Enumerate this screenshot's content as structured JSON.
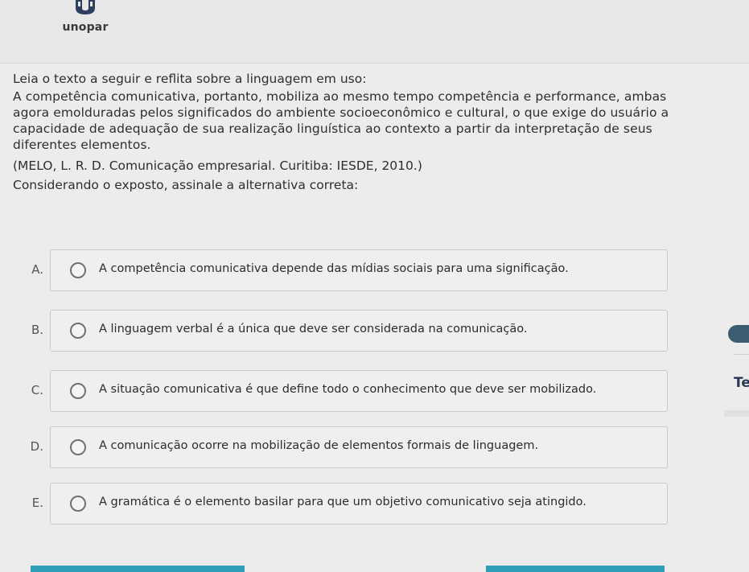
{
  "header": {
    "logo_text": "unopar",
    "logo_color": "#2f3f5f"
  },
  "question": {
    "intro": "Leia o texto a seguir e reflita sobre a linguagem em uso:",
    "quote_lines": [
      "A competência comunicativa, portanto, mobiliza ao mesmo tempo competência e performance, ambas",
      "agora emolduradas pelos significados do ambiente socioeconômico e cultural, o que exige do usuário a",
      "capacidade de adequação de sua realização linguística ao contexto a partir da interpretação de seus",
      "diferentes elementos."
    ],
    "citation": "(MELO, L. R. D. Comunicação empresarial. Curitiba: IESDE, 2010.)",
    "prompt": "Considerando o exposto, assinale a alternativa correta:"
  },
  "options": [
    {
      "letter": "A.",
      "text": "A competência comunicativa depende das mídias sociais para uma significação."
    },
    {
      "letter": "B.",
      "text": "A linguagem verbal é a única que deve ser considerada na comunicação."
    },
    {
      "letter": "C.",
      "text": "A situação comunicativa é que define todo o conhecimento que deve ser mobilizado."
    },
    {
      "letter": "D.",
      "text": "A comunicação ocorre na mobilização de elementos formais de linguagem."
    },
    {
      "letter": "E.",
      "text": "A gramática é o elemento basilar para que um objetivo comunicativo seja atingido."
    }
  ],
  "side": {
    "partial_label": "Te"
  },
  "colors": {
    "accent": "#2f9fb8",
    "side_pill": "#3a5d72"
  }
}
